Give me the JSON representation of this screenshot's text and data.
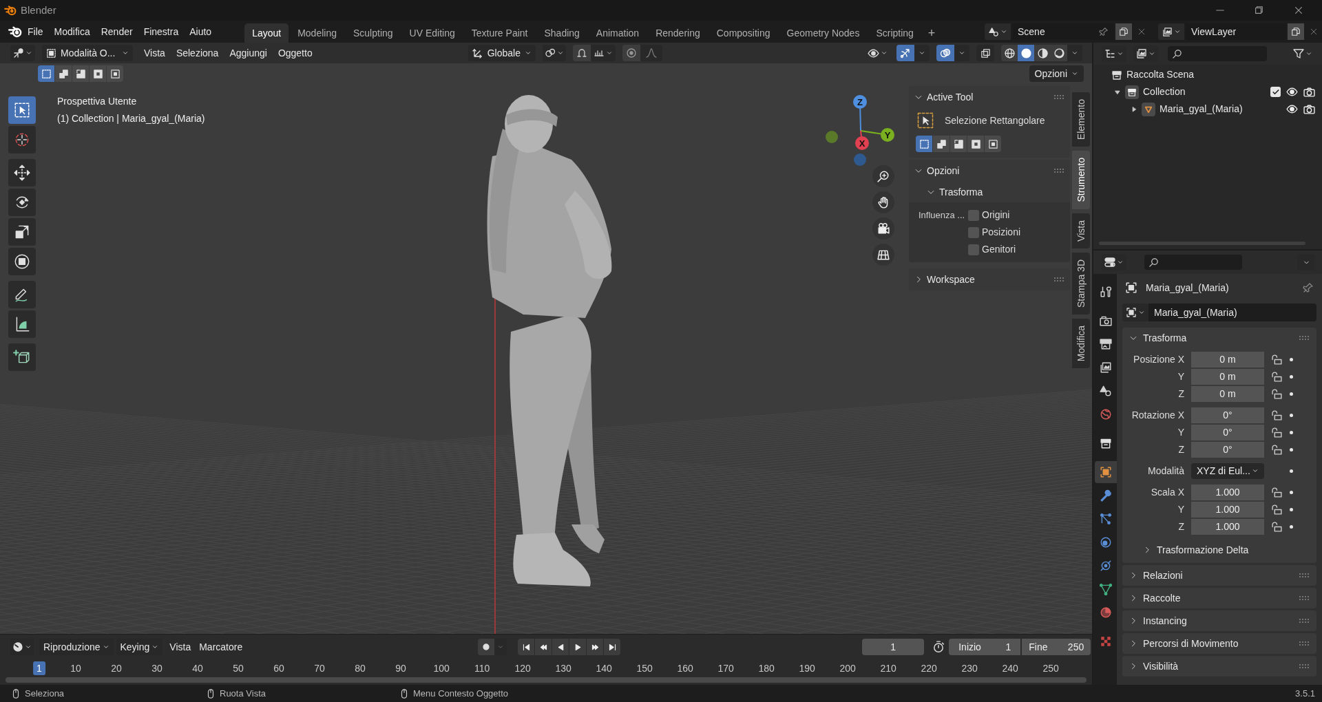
{
  "window": {
    "title": "Blender"
  },
  "menu": [
    "File",
    "Modifica",
    "Render",
    "Finestra",
    "Aiuto"
  ],
  "workspaces": [
    {
      "label": "Layout",
      "selected": true
    },
    {
      "label": "Modeling",
      "selected": false
    },
    {
      "label": "Sculpting",
      "selected": false
    },
    {
      "label": "UV Editing",
      "selected": false
    },
    {
      "label": "Texture Paint",
      "selected": false
    },
    {
      "label": "Shading",
      "selected": false
    },
    {
      "label": "Animation",
      "selected": false
    },
    {
      "label": "Rendering",
      "selected": false
    },
    {
      "label": "Compositing",
      "selected": false
    },
    {
      "label": "Geometry Nodes",
      "selected": false
    },
    {
      "label": "Scripting",
      "selected": false
    }
  ],
  "add_workspace": "+",
  "scene": {
    "name": "Scene"
  },
  "view_layer": {
    "name": "ViewLayer"
  },
  "viewport": {
    "mode": "Modalità O...",
    "menus": [
      "Vista",
      "Seleziona",
      "Aggiungi",
      "Oggetto"
    ],
    "orientation": "Globale",
    "options": "Opzioni",
    "select_modes": [
      {
        "kind": "new",
        "selected": true
      },
      {
        "kind": "extend",
        "selected": false
      },
      {
        "kind": "subtract",
        "selected": false
      },
      {
        "kind": "invert",
        "selected": false
      },
      {
        "kind": "intersect",
        "selected": false
      }
    ],
    "shading": [
      {
        "kind": "wireframe",
        "selected": false
      },
      {
        "kind": "solid",
        "selected": true
      },
      {
        "kind": "material",
        "selected": false
      },
      {
        "kind": "rendered",
        "selected": false
      }
    ],
    "overlay_text": [
      "Prospettiva Utente",
      "(1) Collection | Maria_gyal_(Maria)"
    ],
    "gizmo_axes": [
      "Z",
      "Y",
      "X"
    ],
    "tools": [
      {
        "kind": "select",
        "selected": true
      },
      {
        "kind": "cursor",
        "selected": false
      },
      {
        "kind": "move",
        "selected": false
      },
      {
        "kind": "rotate",
        "selected": false
      },
      {
        "kind": "scale",
        "selected": false
      },
      {
        "kind": "transform",
        "selected": false
      },
      {
        "kind": "annotate",
        "selected": false
      },
      {
        "kind": "measure",
        "selected": false
      },
      {
        "kind": "add_cube",
        "selected": false
      }
    ]
  },
  "sidebar": {
    "tabs": [
      {
        "label": "Elemento",
        "selected": false
      },
      {
        "label": "Strumento",
        "selected": true
      },
      {
        "label": "Vista",
        "selected": false
      },
      {
        "label": "Stampa 3D",
        "selected": false
      },
      {
        "label": "Modifica",
        "selected": false
      }
    ],
    "active_tool": {
      "title": "Active Tool",
      "tool_name": "Selezione Rettangolare",
      "modes": [
        {
          "kind": "new",
          "selected": true
        },
        {
          "kind": "extend",
          "selected": false
        },
        {
          "kind": "subtract",
          "selected": false
        },
        {
          "kind": "invert",
          "selected": false
        },
        {
          "kind": "intersect",
          "selected": false
        }
      ]
    },
    "options": {
      "title": "Opzioni",
      "subtitle": "Trasforma",
      "influence_label": "Influenza ...",
      "checkboxes": [
        {
          "label": "Origini",
          "checked": false
        },
        {
          "label": "Posizioni",
          "checked": false
        },
        {
          "label": "Genitori",
          "checked": false
        }
      ]
    },
    "workspace": {
      "title": "Workspace"
    }
  },
  "outliner": {
    "root": "Raccolta Scena",
    "items": [
      {
        "label": "Collection",
        "kind": "collection",
        "expanded": true,
        "checked": true,
        "children": [
          {
            "label": "Maria_gyal_(Maria)",
            "kind": "mesh",
            "expanded": false
          }
        ]
      }
    ]
  },
  "properties": {
    "object_name": "Maria_gyal_(Maria)",
    "data_name": "Maria_gyal_(Maria)",
    "tabs": [
      {
        "kind": "tool",
        "selected": false
      },
      {
        "kind": "render",
        "selected": false
      },
      {
        "kind": "output",
        "selected": false
      },
      {
        "kind": "view_layer",
        "selected": false
      },
      {
        "kind": "scene",
        "selected": false
      },
      {
        "kind": "world",
        "selected": false
      },
      {
        "kind": "collection",
        "selected": false
      },
      {
        "kind": "object",
        "selected": true
      },
      {
        "kind": "modifiers",
        "selected": false
      },
      {
        "kind": "particles",
        "selected": false
      },
      {
        "kind": "physics",
        "selected": false
      },
      {
        "kind": "constraints",
        "selected": false
      },
      {
        "kind": "data",
        "selected": false
      },
      {
        "kind": "material",
        "selected": false
      },
      {
        "kind": "texture",
        "selected": false
      }
    ],
    "transform": {
      "title": "Trasforma",
      "groups": [
        {
          "kind": "fields",
          "rows": [
            {
              "label": "Posizione X",
              "value": "0 m"
            },
            {
              "label": "Y",
              "value": "0 m"
            },
            {
              "label": "Z",
              "value": "0 m"
            }
          ]
        },
        {
          "kind": "fields",
          "rows": [
            {
              "label": "Rotazione X",
              "value": "0°"
            },
            {
              "label": "Y",
              "value": "0°"
            },
            {
              "label": "Z",
              "value": "0°"
            }
          ]
        },
        {
          "kind": "dropdown",
          "label": "Modalità",
          "value": "XYZ di Eul..."
        },
        {
          "kind": "fields",
          "rows": [
            {
              "label": "Scala X",
              "value": "1.000"
            },
            {
              "label": "Y",
              "value": "1.000"
            },
            {
              "label": "Z",
              "value": "1.000"
            }
          ]
        }
      ],
      "delta": "Trasformazione Delta"
    },
    "panels": [
      {
        "title": "Relazioni"
      },
      {
        "title": "Raccolte"
      },
      {
        "title": "Instancing"
      },
      {
        "title": "Percorsi di Movimento"
      },
      {
        "title": "Visibilità"
      }
    ]
  },
  "timeline": {
    "menus": [
      {
        "label": "Riproduzione",
        "kind": "dropdown"
      },
      {
        "label": "Keying",
        "kind": "dropdown"
      },
      {
        "label": "Vista",
        "kind": "menu"
      },
      {
        "label": "Marcatore",
        "kind": "menu"
      }
    ],
    "current_frame": "1",
    "start_label": "Inizio",
    "start": "1",
    "end_label": "Fine",
    "end": "250",
    "ruler": [
      {
        "label": "1",
        "selected": true
      },
      {
        "label": "10",
        "selected": false
      },
      {
        "label": "20",
        "selected": false
      },
      {
        "label": "30",
        "selected": false
      },
      {
        "label": "40",
        "selected": false
      },
      {
        "label": "50",
        "selected": false
      },
      {
        "label": "60",
        "selected": false
      },
      {
        "label": "70",
        "selected": false
      },
      {
        "label": "80",
        "selected": false
      },
      {
        "label": "90",
        "selected": false
      },
      {
        "label": "100",
        "selected": false
      },
      {
        "label": "110",
        "selected": false
      },
      {
        "label": "120",
        "selected": false
      },
      {
        "label": "130",
        "selected": false
      },
      {
        "label": "140",
        "selected": false
      },
      {
        "label": "150",
        "selected": false
      },
      {
        "label": "160",
        "selected": false
      },
      {
        "label": "170",
        "selected": false
      },
      {
        "label": "180",
        "selected": false
      },
      {
        "label": "190",
        "selected": false
      },
      {
        "label": "200",
        "selected": false
      },
      {
        "label": "210",
        "selected": false
      },
      {
        "label": "220",
        "selected": false
      },
      {
        "label": "230",
        "selected": false
      },
      {
        "label": "240",
        "selected": false
      },
      {
        "label": "250",
        "selected": false
      }
    ]
  },
  "status_bar": {
    "hints": [
      "Seleziona",
      "Ruota Vista",
      "Menu Contesto Oggetto"
    ],
    "version": "3.5.1"
  }
}
